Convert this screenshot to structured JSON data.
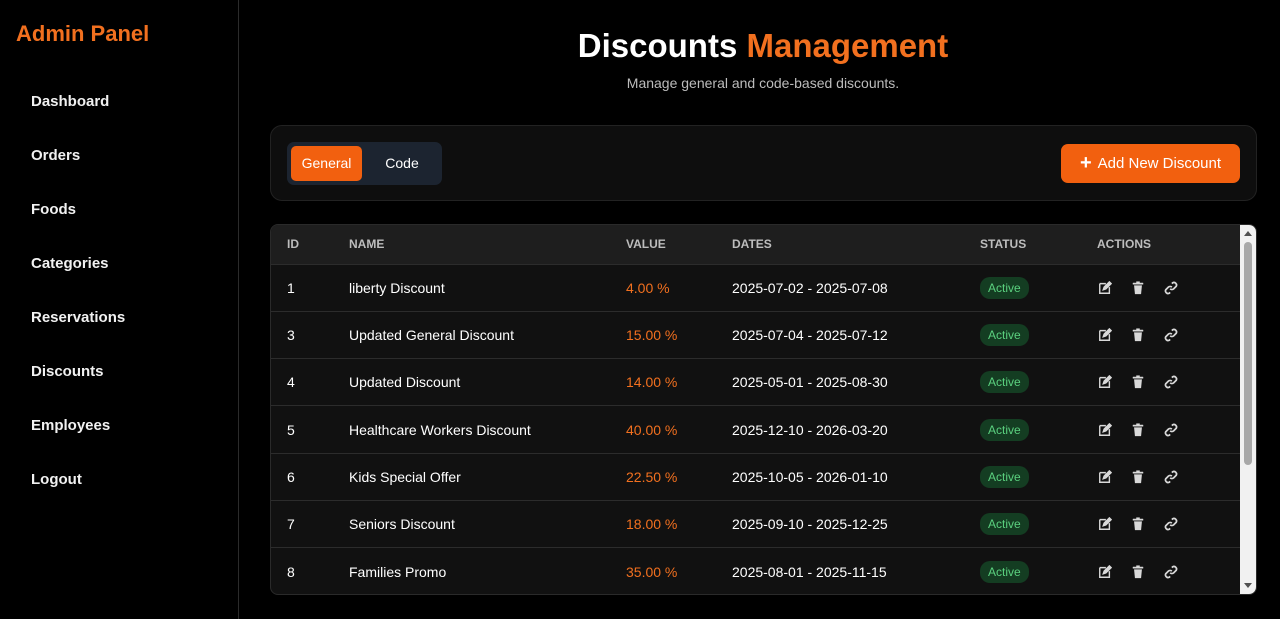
{
  "sidebar": {
    "brand": "Admin Panel",
    "items": [
      {
        "label": "Dashboard"
      },
      {
        "label": "Orders"
      },
      {
        "label": "Foods"
      },
      {
        "label": "Categories"
      },
      {
        "label": "Reservations"
      },
      {
        "label": "Discounts"
      },
      {
        "label": "Employees"
      },
      {
        "label": "Logout"
      }
    ]
  },
  "header": {
    "title_main": "Discounts",
    "title_accent": "Management",
    "subtitle": "Manage general and code-based discounts."
  },
  "toolbar": {
    "tabs": [
      {
        "label": "General",
        "active": true
      },
      {
        "label": "Code",
        "active": false
      }
    ],
    "add_icon": "+",
    "add_label": "Add New Discount"
  },
  "table": {
    "columns": [
      "ID",
      "NAME",
      "VALUE",
      "DATES",
      "STATUS",
      "ACTIONS"
    ],
    "rows": [
      {
        "id": "1",
        "name": "liberty Discount",
        "value": "4.00 %",
        "dates": "2025-07-02 - 2025-07-08",
        "status": "Active"
      },
      {
        "id": "3",
        "name": "Updated General Discount",
        "value": "15.00 %",
        "dates": "2025-07-04 - 2025-07-12",
        "status": "Active"
      },
      {
        "id": "4",
        "name": "Updated Discount",
        "value": "14.00 %",
        "dates": "2025-05-01 - 2025-08-30",
        "status": "Active"
      },
      {
        "id": "5",
        "name": "Healthcare Workers Discount",
        "value": "40.00 %",
        "dates": "2025-12-10 - 2026-03-20",
        "status": "Active"
      },
      {
        "id": "6",
        "name": "Kids Special Offer",
        "value": "22.50 %",
        "dates": "2025-10-05 - 2026-01-10",
        "status": "Active"
      },
      {
        "id": "7",
        "name": "Seniors Discount",
        "value": "18.00 %",
        "dates": "2025-09-10 - 2025-12-25",
        "status": "Active"
      },
      {
        "id": "8",
        "name": "Families Promo",
        "value": "35.00 %",
        "dates": "2025-08-01 - 2025-11-15",
        "status": "Active"
      }
    ],
    "row_actions": [
      "edit-icon",
      "trash-icon",
      "link-icon"
    ]
  },
  "colors": {
    "accent": "#f2701f",
    "button": "#f2600f",
    "status_active_bg": "#143d22",
    "status_active_text": "#5bd17f"
  }
}
